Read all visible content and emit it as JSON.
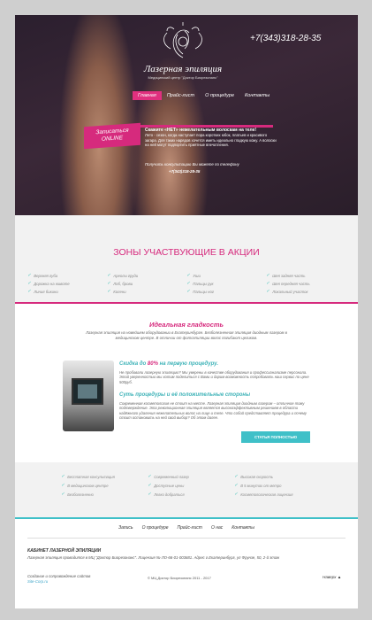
{
  "header": {
    "logo_title": "Лазерная эпиляция",
    "logo_subtitle": "Медицинский центр \"Доктор Биорезонанс\"",
    "phone": "+7(343)318-28-35",
    "nav": [
      "Главная",
      "Прайс-лист",
      "О процедуре",
      "Контакты"
    ],
    "nav_active": 0
  },
  "hero": {
    "cta_line1": "Записаться",
    "cta_line2": "ONLINE",
    "lead": "Скажите «НЕТ» нежелательным волоскам на теле!",
    "text": "Лето - сезон, когда наступает пора коротких юбок, платьев и красивого загара. Для таких нарядов хочется иметь идеально гладкую кожу. А волоски на ней могут подпортить приятные впечатления.",
    "call_text": "Получить консультацию Вы можете по телефону",
    "call_phone": "+7(343)318-28-35"
  },
  "zones": {
    "title": "ЗОНЫ УЧАСТВУЮЩИЕ В АКЦИИ",
    "items": [
      "Верхняя губа",
      "Ареолы груди",
      "Уши",
      "Шея задняя часть",
      "Дорожка на животе",
      "Лоб, брови",
      "Пальцы рук",
      "Шея передняя часть",
      "Линия бикини",
      "Колени",
      "Пальцы ног",
      "Локальный участок"
    ]
  },
  "smooth": {
    "title": "Идеальная гладкость",
    "desc": "Лазерная эпиляция на новейшем оборудовании в Екатеринбурге. Безболезненная эпиляция диодным лазером в медицинском центре. В отличии от фотоэпиляции волос погибают целиком."
  },
  "promo": {
    "title_prefix": "Скидка до ",
    "title_highlight": "80%",
    "title_suffix": " на первую процедуру.",
    "text": "Не пробовали лазерную эпиляцию? Мы уверены в качестве оборудования и профессионализме персонала. Этой уверенностью мы хотим поделиться с Вами и дарим возможность попробовать наш сервис по цене 500руб.",
    "essence_title": "Суть процедуры и её положительные стороны",
    "essence_text": "Современная косметология не стоит на месте. Лазерная эпиляция диодным лазером – отличное тому подтверждение. Эта революционная эпиляция является высокоэффективным решением в области надёжного удаления нежелательных волос на лице и теле. Что собой представляет процедура и почему стоит остановить на ней свой выбор? Об этом далее.",
    "button": "СТАТЬЯ ПОЛНОСТЬЮ"
  },
  "features": [
    "Бесплатная консультация",
    "Современный лазер",
    "Высокая скорость",
    "В медицинском центре",
    "Доступные цены",
    "В 5 минутах от метро",
    "Безболезненно",
    "Легко добраться",
    "Косметологическая лицензия"
  ],
  "footer": {
    "nav": [
      "Запись",
      "О процедуре",
      "Прайс-лист",
      "О нас",
      "Контакты"
    ],
    "cabinet_title": "КАБИНЕТ ЛАЗЕРНОЙ ЭПИЛЯЦИИ",
    "cabinet_text": "Лазерная эпиляция проводится в МЦ \"Доктор Биорезонанс\". Лицензия № ЛО-66-01-003681. Адрес г.Екатеринбург, ул Фрунзе, 50, 2-й этаж",
    "made_text": "Создание и сопровождение сайтов",
    "made_link": "Site-Corp.ru",
    "copyright": "© МЦ Доктор Биорезонанс 2011 - 2017",
    "up": "Наверх ▲"
  },
  "colors": {
    "accent": "#d62a7d",
    "teal": "#3fc0c8"
  }
}
